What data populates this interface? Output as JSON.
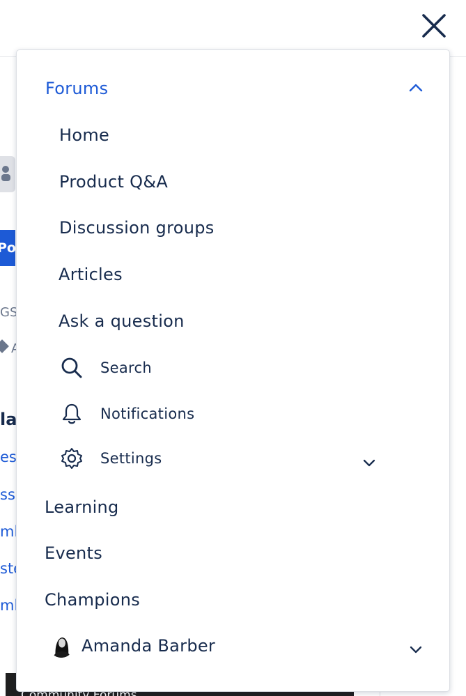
{
  "header": {
    "close_icon": "close-icon"
  },
  "background": {
    "post_label": "Pos",
    "tags_fragment": "GS",
    "tag_fragment": "A",
    "heading_fragment": "la",
    "links": [
      "es",
      "ssi",
      "ml",
      "ste",
      "ml"
    ],
    "bottom_fragment": "Community Forums"
  },
  "menu": {
    "forums": {
      "label": "Forums",
      "expanded": true,
      "icon": "chevron-up-icon"
    },
    "forums_items": [
      {
        "label": "Home"
      },
      {
        "label": "Product Q&A"
      },
      {
        "label": "Discussion groups"
      },
      {
        "label": "Articles"
      },
      {
        "label": "Ask a question"
      }
    ],
    "utility_items": [
      {
        "label": "Search",
        "icon": "search-icon"
      },
      {
        "label": "Notifications",
        "icon": "bell-icon"
      },
      {
        "label": "Settings",
        "icon": "gear-icon",
        "expand_icon": "chevron-down-icon"
      }
    ],
    "sections": [
      {
        "label": "Learning"
      },
      {
        "label": "Events"
      },
      {
        "label": "Champions"
      }
    ],
    "user": {
      "name": "Amanda Barber",
      "expand_icon": "chevron-down-icon"
    }
  },
  "colors": {
    "accent": "#1d5ad6",
    "text": "#172b4d",
    "border": "#dcdfe4"
  }
}
